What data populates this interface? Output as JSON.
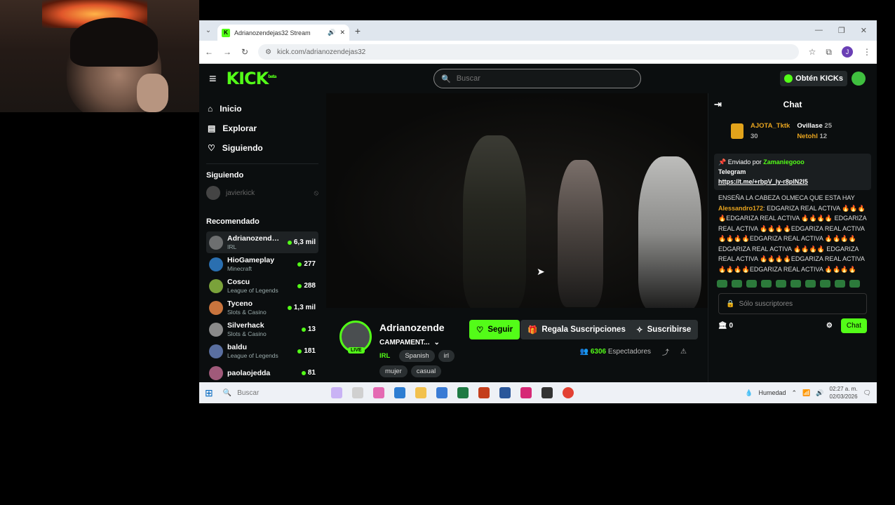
{
  "browser": {
    "tab_title": "Adrianozendejas32 Stream",
    "url": "kick.com/adrianozendejas32"
  },
  "header": {
    "logo": "KICK",
    "logo_sup": "beta",
    "search_placeholder": "Buscar",
    "get_kicks": "Obtén KICKs"
  },
  "sidebar": {
    "nav": [
      "Inicio",
      "Explorar",
      "Siguiendo"
    ],
    "following_title": "Siguiendo",
    "following": [
      {
        "name": "javierkick"
      }
    ],
    "recommended_title": "Recomendado",
    "recommended": [
      {
        "name": "Adrianozendejas32",
        "category": "IRL",
        "viewers": "6,3 mil",
        "color": "#6d6f70"
      },
      {
        "name": "HioGameplay",
        "category": "Minecraft",
        "viewers": "277",
        "color": "#2a6fb0"
      },
      {
        "name": "Coscu",
        "category": "League of Legends",
        "viewers": "288",
        "color": "#7aa23a"
      },
      {
        "name": "Tyceno",
        "category": "Slots & Casino",
        "viewers": "1,3 mil",
        "color": "#c8743d"
      },
      {
        "name": "Silverhack",
        "category": "Slots & Casino",
        "viewers": "13",
        "color": "#8a8a8a"
      },
      {
        "name": "baldu",
        "category": "League of Legends",
        "viewers": "181",
        "color": "#5a6fa0"
      },
      {
        "name": "paolaojedda",
        "category": "",
        "viewers": "81",
        "color": "#a05a7a"
      }
    ]
  },
  "stream": {
    "channel": "Adrianozende",
    "title": "CAMPAMENT...",
    "live_badge": "LIVE",
    "category": "IRL",
    "tags": [
      "Spanish",
      "irl",
      "mujer",
      "casual"
    ],
    "follow": "Seguir",
    "gift": "Regala Suscripciones",
    "subscribe": "Suscribirse",
    "viewers_count": "6306",
    "viewers_label": "Espectadores"
  },
  "chat": {
    "title": "Chat",
    "leaders": [
      {
        "name": "AJOTA_Tktk",
        "count": "30"
      },
      {
        "name": "Ovillase",
        "count": "25"
      },
      {
        "name": "Netohl",
        "count": "12"
      }
    ],
    "pinned_by_label": "Enviado por",
    "pinned_by": "Zamaniegooo",
    "pinned_text": "Telegram",
    "pinned_link": "https://t.me/+rbpV_ly-r8plN2l5",
    "msg_1": "ENSEÑA LA CABEZA OLMECA QUE ESTA HAY",
    "msg_user": "Alessandro172",
    "msg_2": "EDGARIZA REAL ACTIVA 🔥🔥🔥🔥EDGARIZA REAL ACTIVA 🔥🔥🔥🔥 EDGARIZA REAL ACTIVA 🔥🔥🔥🔥EDGARIZA REAL ACTIVA 🔥🔥🔥🔥EDGARIZA REAL ACTIVA 🔥🔥🔥🔥EDGARIZA REAL ACTIVA 🔥🔥🔥🔥 EDGARIZA REAL ACTIVA 🔥🔥🔥🔥EDGARIZA REAL ACTIVA 🔥🔥🔥🔥EDGARIZA REAL ACTIVA 🔥🔥🔥🔥",
    "input_placeholder": "Sólo suscriptores",
    "kicks": "0",
    "send": "Chat"
  },
  "taskbar": {
    "search_placeholder": "Buscar",
    "weather": "Humedad",
    "time": "02:27 a. m.",
    "date": "02/03/2026"
  },
  "colors": {
    "accent": "#53fc18",
    "bg": "#0b0e0f"
  }
}
